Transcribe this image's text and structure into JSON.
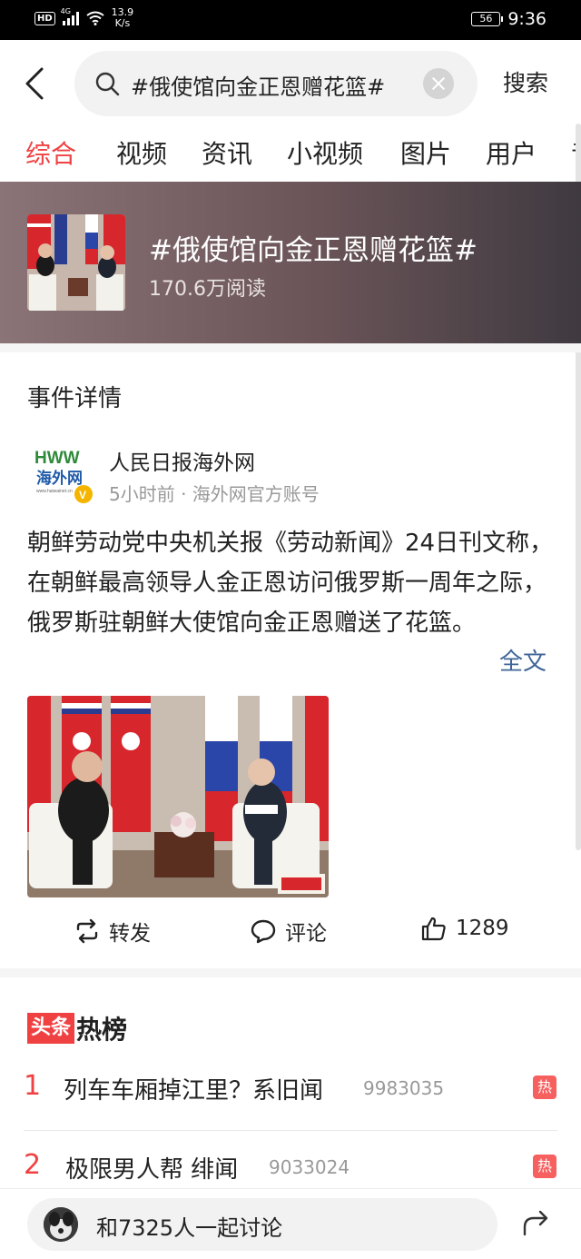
{
  "status_bar": {
    "hd": "HD",
    "network": "4G",
    "speed_value": "13.9",
    "speed_unit": "K/s",
    "battery": "56",
    "time": "9:36"
  },
  "search": {
    "query": "#俄使馆向金正恩赠花篮#",
    "button": "搜索"
  },
  "tabs": [
    {
      "label": "综合",
      "active": true
    },
    {
      "label": "视频"
    },
    {
      "label": "资讯"
    },
    {
      "label": "小视频"
    },
    {
      "label": "图片"
    },
    {
      "label": "用户"
    },
    {
      "label": "音"
    }
  ],
  "topic": {
    "title": "#俄使馆向金正恩赠花篮#",
    "reads": "170.6万阅读"
  },
  "event": {
    "section_title": "事件详情",
    "source_name": "人民日报海外网",
    "source_meta": "5小时前 · 海外网官方账号",
    "logo_text_top": "HWW",
    "logo_text_main": "海外网",
    "logo_text_small": "www.haiwainet.cn",
    "body": "朝鲜劳动党中央机关报《劳动新闻》24日刊文称，在朝鲜最高领导人金正恩访问俄罗斯一周年之际，俄罗斯驻朝鲜大使馆向金正恩赠送了花篮。",
    "full_text_link": "全文",
    "actions": {
      "repost": "转发",
      "comment": "评论",
      "likes": "1289"
    }
  },
  "hot_list": {
    "badge": "头条",
    "title": "热榜",
    "items": [
      {
        "rank": "1",
        "title": "列车车厢掉江里？系旧闻",
        "count": "9983035",
        "tag": "热"
      },
      {
        "rank": "2",
        "title": "极限男人帮 绯闻",
        "count": "9033024",
        "tag": "热"
      }
    ]
  },
  "bottom_bar": {
    "discuss": "和7325人一起讨论"
  },
  "colors": {
    "accent": "#f04142",
    "link": "#406599",
    "meta": "#999999"
  }
}
